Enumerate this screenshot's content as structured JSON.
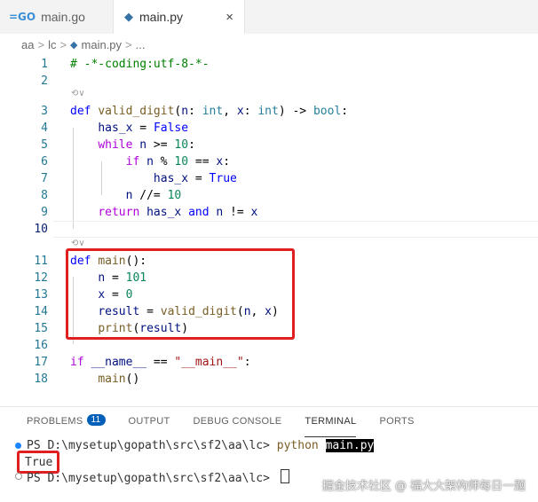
{
  "tabs": [
    {
      "label": "main.go",
      "icon": "go-icon"
    },
    {
      "label": "main.py",
      "icon": "python-icon",
      "close": "×"
    }
  ],
  "breadcrumb": [
    "aa",
    "lc",
    "main.py",
    "..."
  ],
  "lens": "⟲∨",
  "code_lines": [
    {
      "n": "1",
      "text": "# -*-coding:utf-8-*-"
    },
    {
      "n": "2",
      "text": ""
    },
    {
      "n": "3",
      "text": "def valid_digit(n: int, x: int) -> bool:"
    },
    {
      "n": "4",
      "text": "    has_x = False"
    },
    {
      "n": "5",
      "text": "    while n >= 10:"
    },
    {
      "n": "6",
      "text": "        if n % 10 == x:"
    },
    {
      "n": "7",
      "text": "            has_x = True"
    },
    {
      "n": "8",
      "text": "        n //= 10"
    },
    {
      "n": "9",
      "text": "    return has_x and n != x"
    },
    {
      "n": "10",
      "text": ""
    },
    {
      "n": "11",
      "text": "def main():"
    },
    {
      "n": "12",
      "text": "    n = 101"
    },
    {
      "n": "13",
      "text": "    x = 0"
    },
    {
      "n": "14",
      "text": "    result = valid_digit(n, x)"
    },
    {
      "n": "15",
      "text": "    print(result)"
    },
    {
      "n": "16",
      "text": ""
    },
    {
      "n": "17",
      "text": "if __name__ == \"__main__\":"
    },
    {
      "n": "18",
      "text": "    main()"
    }
  ],
  "panel": {
    "tabs": [
      "PROBLEMS",
      "OUTPUT",
      "DEBUG CONSOLE",
      "TERMINAL",
      "PORTS"
    ],
    "problems_count": "11",
    "active": "TERMINAL"
  },
  "terminal": {
    "prompt": "PS D:\\mysetup\\gopath\\src\\sf2\\aa\\lc> ",
    "command": "python",
    "arg": "main.py",
    "output": "True"
  },
  "watermark": "掘金技术社区 @ 福大大架构师每日一题",
  "colors": {
    "keyword": "#0000ff",
    "control": "#af00db",
    "function": "#795e26",
    "type": "#267f99",
    "number": "#098658",
    "comment": "#008000",
    "string": "#a31515",
    "highlight_box": "#e02020",
    "badge": "#005fb8"
  }
}
